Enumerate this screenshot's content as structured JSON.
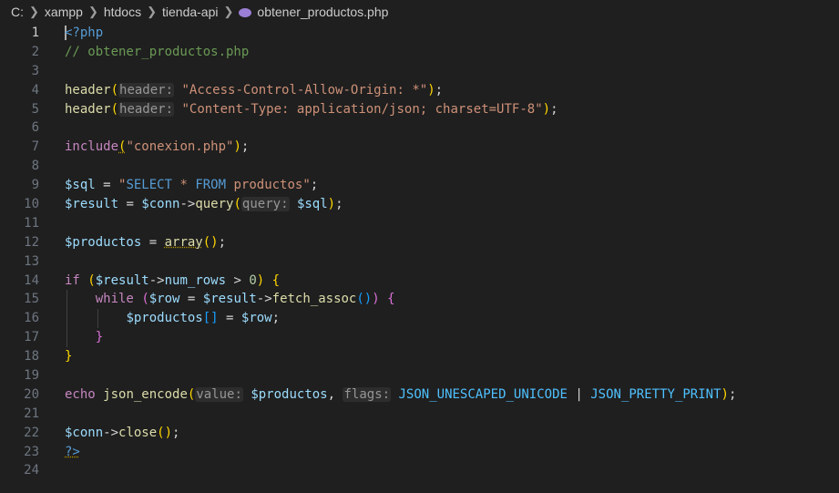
{
  "breadcrumb": {
    "items": [
      "C:",
      "xampp",
      "htdocs",
      "tienda-api"
    ],
    "file": "obtener_productos.php"
  },
  "lines": [
    {
      "n": "1",
      "parts": [
        [
          "tag",
          "<?php"
        ]
      ]
    },
    {
      "n": "2",
      "parts": [
        [
          "cm",
          "// obtener_productos.php"
        ]
      ]
    },
    {
      "n": "3",
      "parts": []
    },
    {
      "n": "4",
      "parts": [
        [
          "fn",
          "header"
        ],
        [
          "br1",
          "("
        ],
        [
          "hint",
          "header:"
        ],
        [
          "plain",
          " "
        ],
        [
          "str",
          "\"Access-Control-Allow-Origin: *\""
        ],
        [
          "br1",
          ")"
        ],
        [
          "plain",
          ";"
        ]
      ]
    },
    {
      "n": "5",
      "parts": [
        [
          "fn",
          "header"
        ],
        [
          "br1",
          "("
        ],
        [
          "hint",
          "header:"
        ],
        [
          "plain",
          " "
        ],
        [
          "str",
          "\"Content-Type: application/json; charset=UTF-8\""
        ],
        [
          "br1",
          ")"
        ],
        [
          "plain",
          ";"
        ]
      ]
    },
    {
      "n": "6",
      "parts": []
    },
    {
      "n": "7",
      "parts": [
        [
          "kwc",
          "include"
        ],
        [
          "br1w",
          "("
        ],
        [
          "str",
          "\"conexion.php\""
        ],
        [
          "br1",
          ")"
        ],
        [
          "plain",
          ";"
        ]
      ]
    },
    {
      "n": "8",
      "parts": []
    },
    {
      "n": "9",
      "parts": [
        [
          "var",
          "$sql"
        ],
        [
          "plain",
          " = "
        ],
        [
          "str",
          "\""
        ],
        [
          "kw",
          "SELECT"
        ],
        [
          "str",
          " * "
        ],
        [
          "kw",
          "FROM"
        ],
        [
          "str",
          " productos\""
        ],
        [
          "plain",
          ";"
        ]
      ]
    },
    {
      "n": "10",
      "parts": [
        [
          "var",
          "$result"
        ],
        [
          "plain",
          " = "
        ],
        [
          "var",
          "$conn"
        ],
        [
          "plain",
          "->"
        ],
        [
          "fn",
          "query"
        ],
        [
          "br1",
          "("
        ],
        [
          "hint",
          "query:"
        ],
        [
          "plain",
          " "
        ],
        [
          "var",
          "$sql"
        ],
        [
          "br1",
          ")"
        ],
        [
          "plain",
          ";"
        ]
      ]
    },
    {
      "n": "11",
      "parts": []
    },
    {
      "n": "12",
      "parts": [
        [
          "var",
          "$productos"
        ],
        [
          "plain",
          " = "
        ],
        [
          "kww",
          "array"
        ],
        [
          "br1",
          "()"
        ],
        [
          "plain",
          ";"
        ]
      ]
    },
    {
      "n": "13",
      "parts": []
    },
    {
      "n": "14",
      "parts": [
        [
          "kwc",
          "if"
        ],
        [
          "plain",
          " "
        ],
        [
          "br1",
          "("
        ],
        [
          "var",
          "$result"
        ],
        [
          "plain",
          "->"
        ],
        [
          "var",
          "num_rows"
        ],
        [
          "plain",
          " > "
        ],
        [
          "num",
          "0"
        ],
        [
          "br1",
          ")"
        ],
        [
          "plain",
          " "
        ],
        [
          "br1",
          "{"
        ]
      ]
    },
    {
      "n": "15",
      "parts": [
        [
          "ind",
          "    "
        ],
        [
          "kwc",
          "while"
        ],
        [
          "plain",
          " "
        ],
        [
          "br2",
          "("
        ],
        [
          "var",
          "$row"
        ],
        [
          "plain",
          " = "
        ],
        [
          "var",
          "$result"
        ],
        [
          "plain",
          "->"
        ],
        [
          "fn",
          "fetch_assoc"
        ],
        [
          "br3",
          "()"
        ],
        [
          "br2",
          ")"
        ],
        [
          "plain",
          " "
        ],
        [
          "br2",
          "{"
        ]
      ]
    },
    {
      "n": "16",
      "parts": [
        [
          "ind",
          "        "
        ],
        [
          "var",
          "$productos"
        ],
        [
          "br3",
          "[]"
        ],
        [
          "plain",
          " = "
        ],
        [
          "var",
          "$row"
        ],
        [
          "plain",
          ";"
        ]
      ]
    },
    {
      "n": "17",
      "parts": [
        [
          "ind",
          "    "
        ],
        [
          "br2",
          "}"
        ]
      ]
    },
    {
      "n": "18",
      "parts": [
        [
          "br1",
          "}"
        ]
      ]
    },
    {
      "n": "19",
      "parts": []
    },
    {
      "n": "20",
      "parts": [
        [
          "kwc",
          "echo"
        ],
        [
          "plain",
          " "
        ],
        [
          "fn",
          "json_encode"
        ],
        [
          "br1",
          "("
        ],
        [
          "hint",
          "value:"
        ],
        [
          "plain",
          " "
        ],
        [
          "var",
          "$productos"
        ],
        [
          "plain",
          ", "
        ],
        [
          "hint",
          "flags:"
        ],
        [
          "plain",
          " "
        ],
        [
          "const",
          "JSON_UNESCAPED_UNICODE"
        ],
        [
          "plain",
          " | "
        ],
        [
          "const",
          "JSON_PRETTY_PRINT"
        ],
        [
          "br1",
          ")"
        ],
        [
          "plain",
          ";"
        ]
      ]
    },
    {
      "n": "21",
      "parts": []
    },
    {
      "n": "22",
      "parts": [
        [
          "var",
          "$conn"
        ],
        [
          "plain",
          "->"
        ],
        [
          "fn",
          "close"
        ],
        [
          "br1",
          "()"
        ],
        [
          "plain",
          ";"
        ]
      ]
    },
    {
      "n": "23",
      "parts": [
        [
          "tagw",
          "?>"
        ]
      ]
    },
    {
      "n": "24",
      "parts": []
    }
  ],
  "colors": {
    "background": "#1f1f1f",
    "string": "#ce9178",
    "variable": "#9cdcfe",
    "function": "#dcdcaa",
    "keyword": "#c586c0",
    "comment": "#6a9955"
  }
}
